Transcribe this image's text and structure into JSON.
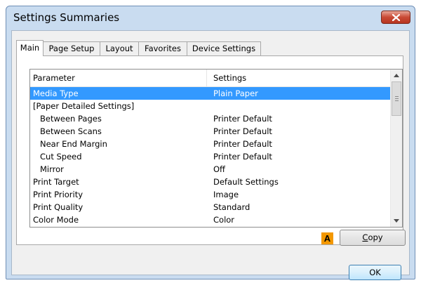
{
  "window": {
    "title": "Settings Summaries",
    "close_icon": "close-x-icon"
  },
  "tabs": [
    {
      "label": "Main",
      "active": true
    },
    {
      "label": "Page Setup",
      "active": false
    },
    {
      "label": "Layout",
      "active": false
    },
    {
      "label": "Favorites",
      "active": false
    },
    {
      "label": "Device Settings",
      "active": false
    }
  ],
  "list": {
    "columns": [
      "Parameter",
      "Settings"
    ],
    "rows": [
      {
        "param": "Media Type",
        "value": "Plain Paper",
        "selected": true
      },
      {
        "param": "[Paper Detailed Settings]",
        "value": ""
      },
      {
        "param": "Between Pages",
        "value": "Printer Default"
      },
      {
        "param": "Between Scans",
        "value": "Printer Default"
      },
      {
        "param": "Near End Margin",
        "value": "Printer Default"
      },
      {
        "param": "Cut Speed",
        "value": "Printer Default"
      },
      {
        "param": "Mirror",
        "value": "Off"
      },
      {
        "param": "Print Target",
        "value": "Default Settings"
      },
      {
        "param": "Print Priority",
        "value": "Image"
      },
      {
        "param": "Print Quality",
        "value": "Standard"
      },
      {
        "param": "Color Mode",
        "value": "Color"
      }
    ]
  },
  "annotation_badge": "A",
  "buttons": {
    "copy": {
      "mnemonic": "C",
      "rest": "opy"
    },
    "ok": "OK"
  },
  "colors": {
    "selection": "#3399ff",
    "badge": "#f39800",
    "close_button": "#c94a35",
    "frame": "#c9dcf0"
  }
}
